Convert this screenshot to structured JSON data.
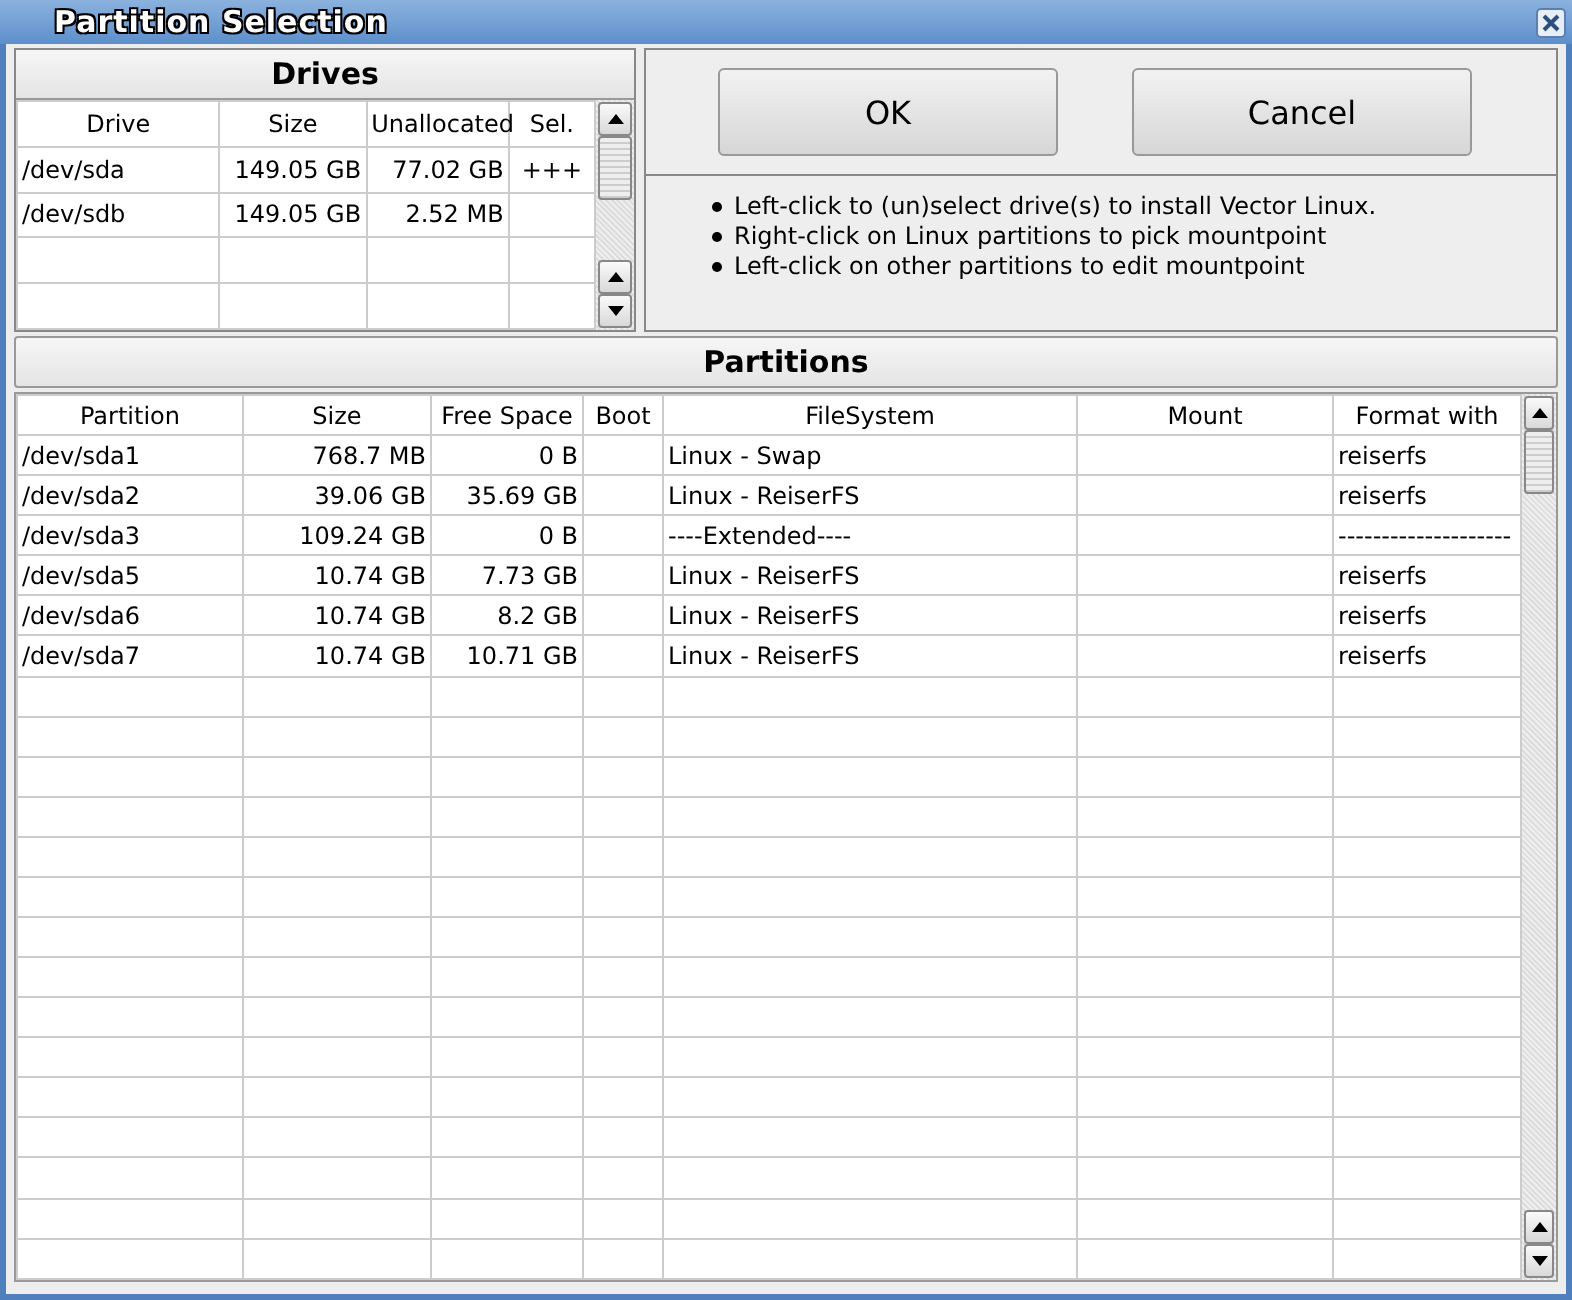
{
  "window": {
    "title": "Partition Selection"
  },
  "drives": {
    "title": "Drives",
    "columns": [
      "Drive",
      "Size",
      "Unallocated",
      "Sel."
    ],
    "rows": [
      [
        "/dev/sda",
        "149.05 GB",
        "77.02 GB",
        "+++"
      ],
      [
        "/dev/sdb",
        "149.05 GB",
        "2.52 MB",
        ""
      ]
    ]
  },
  "buttons": [
    "OK",
    "Cancel"
  ],
  "hints": [
    "Left-click to (un)select drive(s) to install Vector Linux.",
    "Right-click on Linux partitions to pick mountpoint",
    "Left-click on other partitions to edit mountpoint"
  ],
  "partitions": {
    "title": "Partitions",
    "columns": [
      "Partition",
      "Size",
      "Free Space",
      "Boot",
      "FileSystem",
      "Mount",
      "Format with"
    ],
    "rows": [
      [
        "/dev/sda1",
        "768.7 MB",
        "0 B",
        "",
        "Linux - Swap",
        "",
        "reiserfs"
      ],
      [
        "/dev/sda2",
        "39.06 GB",
        "35.69 GB",
        "",
        "Linux - ReiserFS",
        "",
        "reiserfs"
      ],
      [
        "/dev/sda3",
        "109.24 GB",
        "0 B",
        "",
        "----Extended----",
        "",
        "--------------------"
      ],
      [
        "/dev/sda5",
        "10.74 GB",
        "7.73 GB",
        "",
        "Linux - ReiserFS",
        "",
        "reiserfs"
      ],
      [
        "/dev/sda6",
        "10.74 GB",
        "8.2 GB",
        "",
        "Linux - ReiserFS",
        "",
        "reiserfs"
      ],
      [
        "/dev/sda7",
        "10.74 GB",
        "10.71 GB",
        "",
        "Linux - ReiserFS",
        "",
        "reiserfs"
      ]
    ]
  }
}
